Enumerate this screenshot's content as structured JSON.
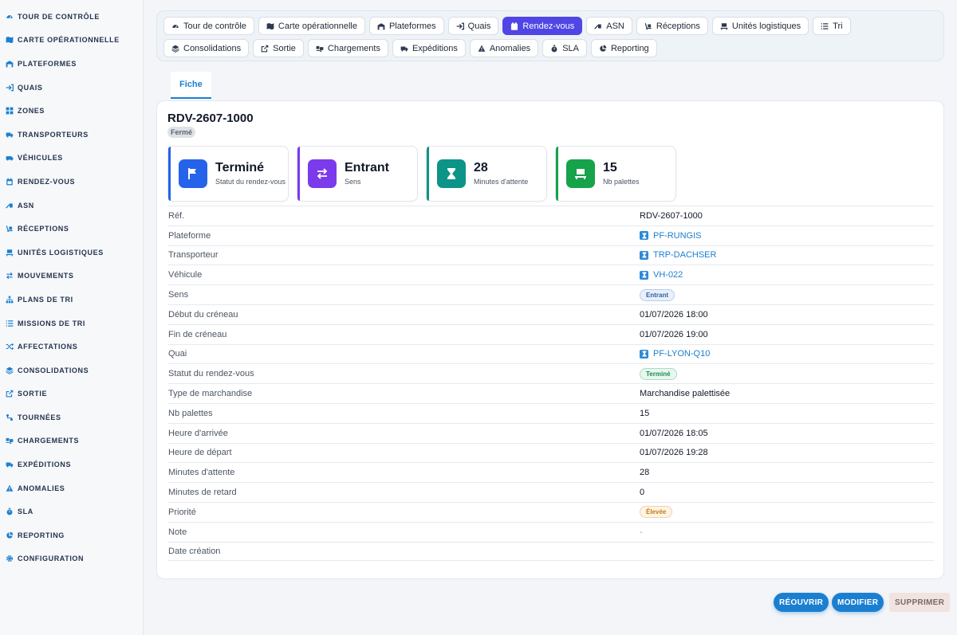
{
  "sidebar": {
    "items": [
      {
        "label": "TOUR DE CONTRÔLE",
        "icon": "gauge-icon"
      },
      {
        "label": "CARTE OPÉRATIONNELLE",
        "icon": "map-icon"
      },
      {
        "label": "PLATEFORMES",
        "icon": "warehouse-icon"
      },
      {
        "label": "QUAIS",
        "icon": "sign-in-icon"
      },
      {
        "label": "ZONES",
        "icon": "grid-icon"
      },
      {
        "label": "TRANSPORTEURS",
        "icon": "truck-icon"
      },
      {
        "label": "VÉHICULES",
        "icon": "van-icon"
      },
      {
        "label": "RENDEZ-VOUS",
        "icon": "calendar-icon"
      },
      {
        "label": "ASN",
        "icon": "truck-ramp-icon"
      },
      {
        "label": "RÉCEPTIONS",
        "icon": "dolly-icon"
      },
      {
        "label": "UNITÉS LOGISTIQUES",
        "icon": "pallet-icon"
      },
      {
        "label": "MOUVEMENTS",
        "icon": "arrows-icon"
      },
      {
        "label": "PLANS DE TRI",
        "icon": "sitemap-icon"
      },
      {
        "label": "MISSIONS DE TRI",
        "icon": "list-icon"
      },
      {
        "label": "AFFECTATIONS",
        "icon": "shuffle-icon"
      },
      {
        "label": "CONSOLIDATIONS",
        "icon": "layers-icon"
      },
      {
        "label": "SORTIE",
        "icon": "export-icon"
      },
      {
        "label": "TOURNÉES",
        "icon": "route-icon"
      },
      {
        "label": "CHARGEMENTS",
        "icon": "truck-loading-icon"
      },
      {
        "label": "EXPÉDITIONS",
        "icon": "shipping-icon"
      },
      {
        "label": "ANOMALIES",
        "icon": "warning-icon"
      },
      {
        "label": "SLA",
        "icon": "stopwatch-icon"
      },
      {
        "label": "REPORTING",
        "icon": "chart-pie-icon"
      },
      {
        "label": "CONFIGURATION",
        "icon": "cog-icon"
      }
    ]
  },
  "topnav": {
    "items": [
      {
        "label": "Tour de contrôle",
        "icon": "gauge-icon",
        "active": false
      },
      {
        "label": "Carte opérationnelle",
        "icon": "map-icon",
        "active": false
      },
      {
        "label": "Plateformes",
        "icon": "warehouse-icon",
        "active": false
      },
      {
        "label": "Quais",
        "icon": "sign-in-icon",
        "active": false
      },
      {
        "label": "Rendez-vous",
        "icon": "calendar-icon",
        "active": true
      },
      {
        "label": "ASN",
        "icon": "truck-ramp-icon",
        "active": false
      },
      {
        "label": "Réceptions",
        "icon": "dolly-icon",
        "active": false
      },
      {
        "label": "Unités logistiques",
        "icon": "pallet-icon",
        "active": false
      },
      {
        "label": "Tri",
        "icon": "list-icon",
        "active": false
      },
      {
        "label": "Consolidations",
        "icon": "layers-icon",
        "active": false
      },
      {
        "label": "Sortie",
        "icon": "export-icon",
        "active": false
      },
      {
        "label": "Chargements",
        "icon": "truck-loading-icon",
        "active": false
      },
      {
        "label": "Expéditions",
        "icon": "shipping-icon",
        "active": false
      },
      {
        "label": "Anomalies",
        "icon": "warning-icon",
        "active": false
      },
      {
        "label": "SLA",
        "icon": "stopwatch-icon",
        "active": false
      },
      {
        "label": "Reporting",
        "icon": "chart-pie-icon",
        "active": false
      }
    ]
  },
  "tabs": {
    "fiche": "Fiche"
  },
  "record": {
    "title": "RDV-2607-1000",
    "status": "Fermé"
  },
  "stats": [
    {
      "value": "Terminé",
      "label": "Statut du rendez-vous",
      "color": "#2563eb",
      "icon": "flag-icon"
    },
    {
      "value": "Entrant",
      "label": "Sens",
      "color": "#7c3aed",
      "icon": "exchange-icon"
    },
    {
      "value": "28",
      "label": "Minutes d'attente",
      "color": "#0d9488",
      "icon": "hourglass-icon"
    },
    {
      "value": "15",
      "label": "Nb palettes",
      "color": "#16a34a",
      "icon": "pallet-icon"
    }
  ],
  "details": [
    {
      "key": "Réf.",
      "value": "RDV-2607-1000",
      "type": "text"
    },
    {
      "key": "Plateforme",
      "value": "PF-RUNGIS",
      "type": "link"
    },
    {
      "key": "Transporteur",
      "value": "TRP-DACHSER",
      "type": "link"
    },
    {
      "key": "Véhicule",
      "value": "VH-022",
      "type": "link"
    },
    {
      "key": "Sens",
      "value": "Entrant",
      "type": "pill-blue"
    },
    {
      "key": "Début du créneau",
      "value": "01/07/2026 18:00",
      "type": "text"
    },
    {
      "key": "Fin de créneau",
      "value": "01/07/2026 19:00",
      "type": "text"
    },
    {
      "key": "Quai",
      "value": "PF-LYON-Q10",
      "type": "link"
    },
    {
      "key": "Statut du rendez-vous",
      "value": "Terminé",
      "type": "pill-green"
    },
    {
      "key": "Type de marchandise",
      "value": "Marchandise palettisée",
      "type": "text"
    },
    {
      "key": "Nb palettes",
      "value": "15",
      "type": "text"
    },
    {
      "key": "Heure d'arrivée",
      "value": "01/07/2026 18:05",
      "type": "text"
    },
    {
      "key": "Heure de départ",
      "value": "01/07/2026 19:28",
      "type": "text"
    },
    {
      "key": "Minutes d'attente",
      "value": "28",
      "type": "text"
    },
    {
      "key": "Minutes de retard",
      "value": "0",
      "type": "text"
    },
    {
      "key": "Priorité",
      "value": "Élevée",
      "type": "pill-orange"
    },
    {
      "key": "Note",
      "value": "-",
      "type": "muted"
    },
    {
      "key": "Date création",
      "value": "",
      "type": "text"
    }
  ],
  "actions": {
    "reopen": "RÉOUVRIR",
    "edit": "MODIFIER",
    "delete": "SUPPRIMER"
  }
}
